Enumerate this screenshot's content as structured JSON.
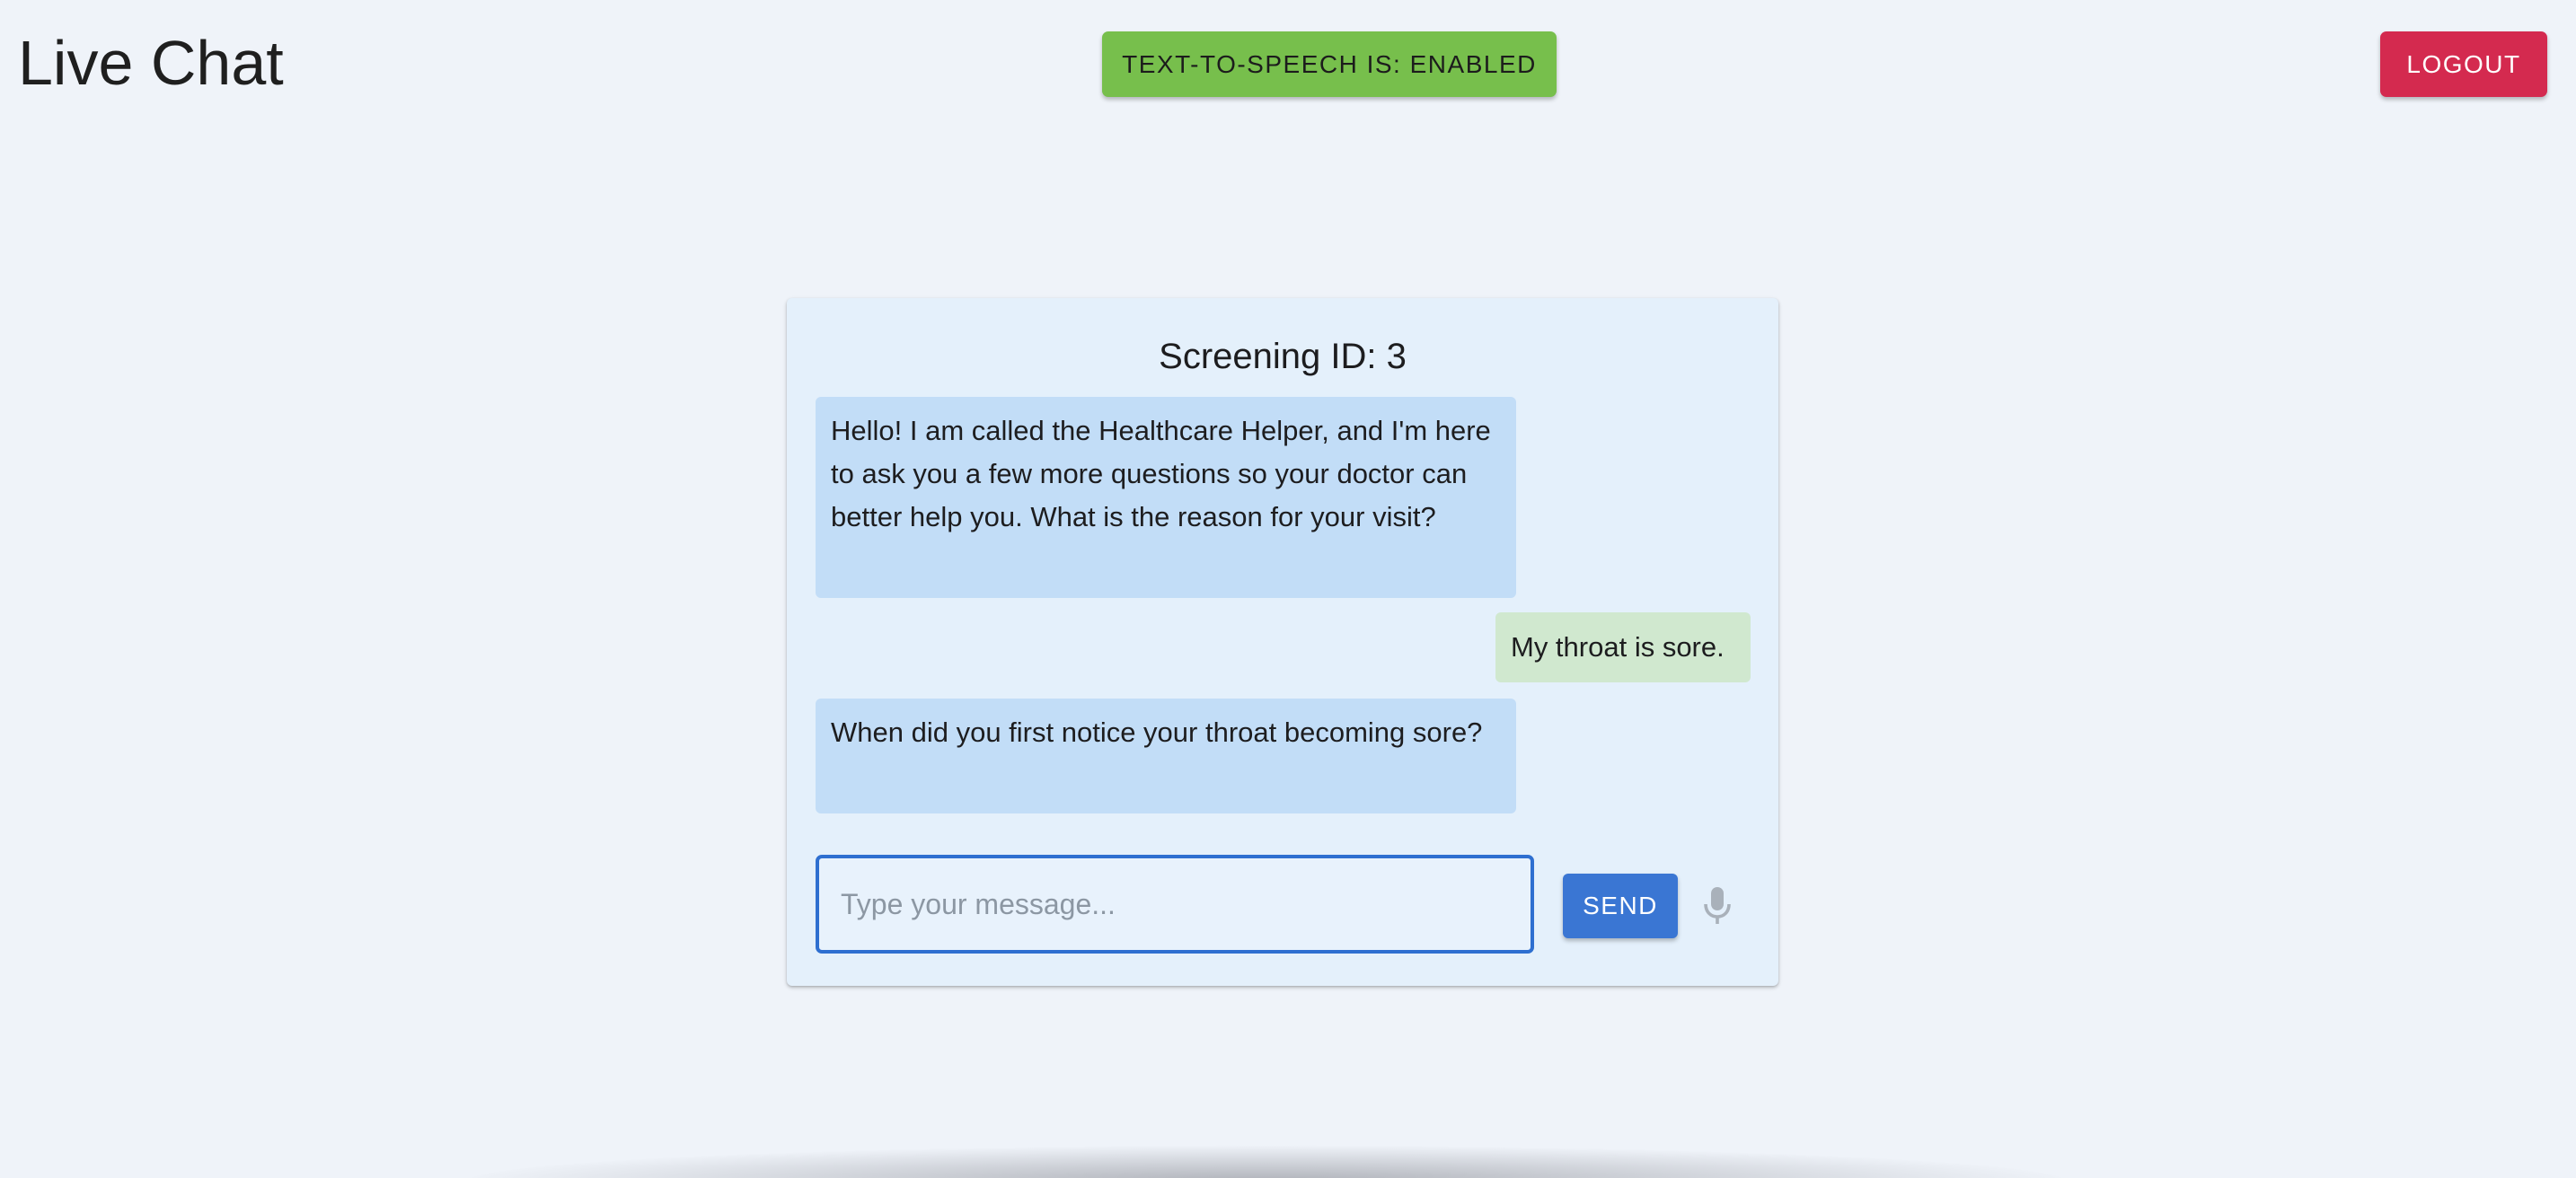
{
  "header": {
    "app_title": "Live Chat",
    "tts_label": "TEXT-TO-SPEECH IS: ENABLED",
    "logout_label": "LOGOUT"
  },
  "chat": {
    "screening_title": "Screening ID: 3",
    "messages": [
      {
        "sender": "bot",
        "text": "Hello! I am called the Healthcare Helper, and I'm here to ask you a few more questions so your doctor can better help you. What is the reason for your visit?"
      },
      {
        "sender": "user",
        "text": "My throat is sore."
      },
      {
        "sender": "bot",
        "text": "When did you first notice your throat becoming sore?"
      }
    ],
    "input": {
      "value": "",
      "placeholder": "Type your message..."
    },
    "send_label": "SEND",
    "mic_icon": "microphone-icon"
  },
  "colors": {
    "background": "#eff3f9",
    "tts_enabled": "#77bf4c",
    "logout": "#d42a4f",
    "send": "#3a76d3",
    "bot_bubble": "#c2ddf7",
    "user_bubble": "#d0e8cf",
    "card": "#e4f0fb"
  }
}
